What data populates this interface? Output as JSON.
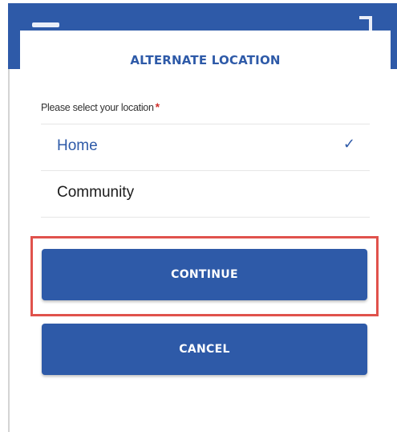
{
  "dialog": {
    "title": "ALTERNATE LOCATION",
    "field_label": "Please select your location",
    "required_marker": "*",
    "options": [
      {
        "label": "Home",
        "selected": true,
        "check": "✓"
      },
      {
        "label": "Community",
        "selected": false
      }
    ],
    "buttons": {
      "continue_label": "CONTINUE",
      "cancel_label": "CANCEL"
    }
  },
  "icons": {
    "menu": "hamburger-icon",
    "corner": "corner-icon",
    "check": "check-icon"
  },
  "colors": {
    "primary": "#2e5aa8",
    "required": "#d0312d",
    "highlight": "#e0524c"
  }
}
